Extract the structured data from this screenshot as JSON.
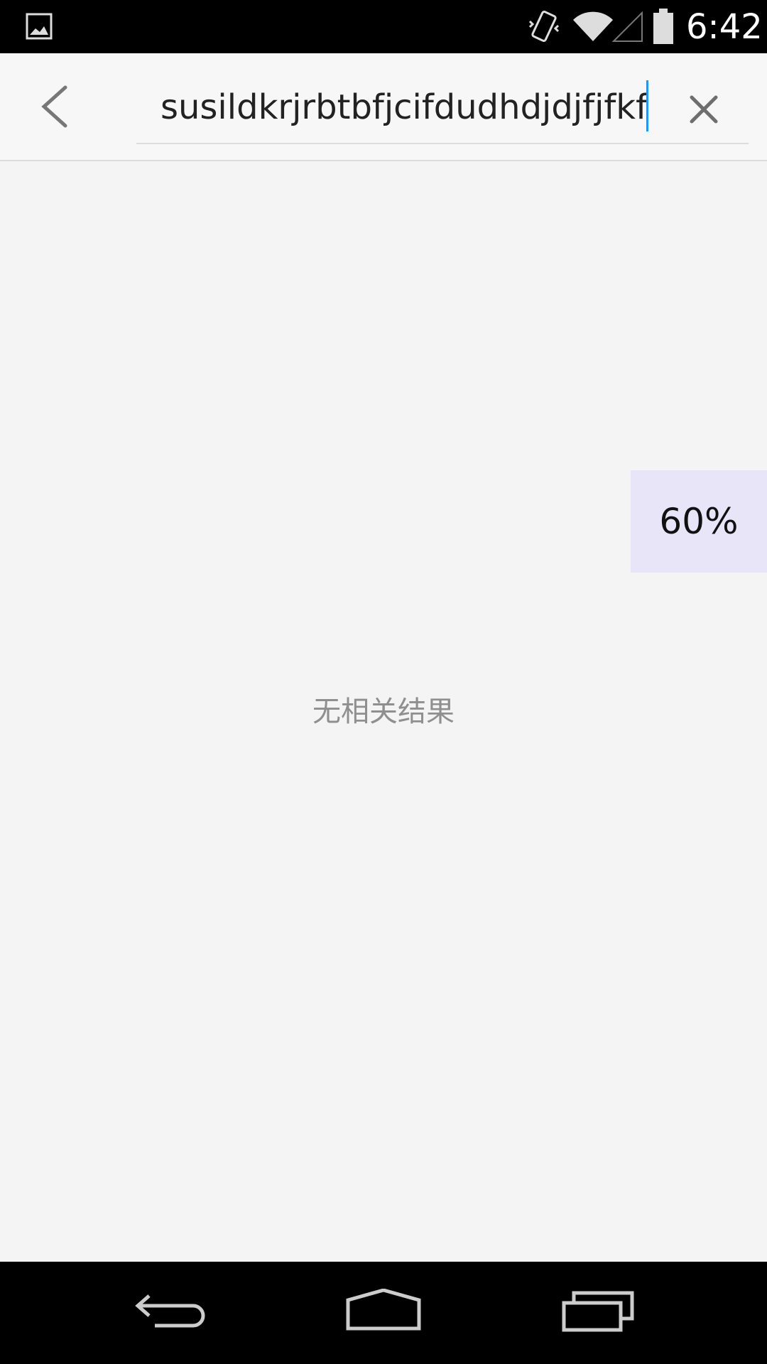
{
  "status_bar": {
    "time": "6:42",
    "icons": [
      "gallery-icon",
      "vibrate-icon",
      "wifi-icon",
      "signal-icon",
      "battery-icon"
    ]
  },
  "search": {
    "query": "susildkrjrbtbfjcifdudhdjdjfjfkf",
    "back_icon": "chevron-left-icon",
    "clear_icon": "close-icon",
    "cursor_color": "#2196f3"
  },
  "results": {
    "empty_message": "无相关结果"
  },
  "zoom": {
    "level": "60%"
  },
  "nav_bar": {
    "icons": [
      "back-icon",
      "home-icon",
      "recents-icon"
    ]
  }
}
